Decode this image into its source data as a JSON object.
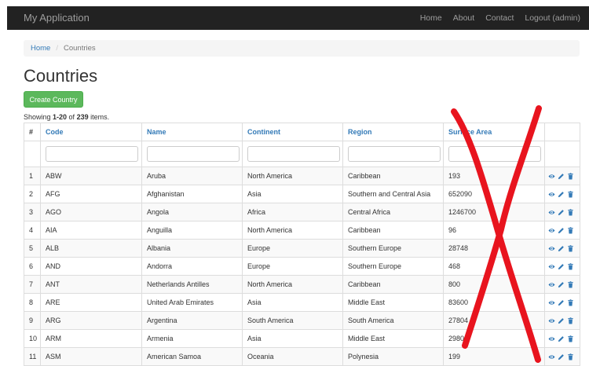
{
  "navbar": {
    "brand": "My Application",
    "links": [
      "Home",
      "About",
      "Contact",
      "Logout (admin)"
    ]
  },
  "breadcrumb": {
    "home": "Home",
    "separator": "/",
    "current": "Countries"
  },
  "page_title": "Countries",
  "create_button": "Create Country",
  "summary": {
    "prefix": "Showing ",
    "range": "1-20",
    "middle": " of ",
    "total": "239",
    "suffix": " items."
  },
  "table": {
    "headers": [
      "#",
      "Code",
      "Name",
      "Continent",
      "Region",
      "Surface Area"
    ],
    "rows": [
      [
        "1",
        "ABW",
        "Aruba",
        "North America",
        "Caribbean",
        "193"
      ],
      [
        "2",
        "AFG",
        "Afghanistan",
        "Asia",
        "Southern and Central Asia",
        "652090"
      ],
      [
        "3",
        "AGO",
        "Angola",
        "Africa",
        "Central Africa",
        "1246700"
      ],
      [
        "4",
        "AIA",
        "Anguilla",
        "North America",
        "Caribbean",
        "96"
      ],
      [
        "5",
        "ALB",
        "Albania",
        "Europe",
        "Southern Europe",
        "28748"
      ],
      [
        "6",
        "AND",
        "Andorra",
        "Europe",
        "Southern Europe",
        "468"
      ],
      [
        "7",
        "ANT",
        "Netherlands Antilles",
        "North America",
        "Caribbean",
        "800"
      ],
      [
        "8",
        "ARE",
        "United Arab Emirates",
        "Asia",
        "Middle East",
        "83600"
      ],
      [
        "9",
        "ARG",
        "Argentina",
        "South America",
        "South America",
        "27804"
      ],
      [
        "10",
        "ARM",
        "Armenia",
        "Asia",
        "Middle East",
        "2980"
      ],
      [
        "11",
        "ASM",
        "American Samoa",
        "Oceania",
        "Polynesia",
        "199"
      ]
    ],
    "row_actions": [
      "eye-icon",
      "pencil-icon",
      "trash-icon"
    ]
  },
  "colors": {
    "navbar_bg": "#222222",
    "link": "#337ab7",
    "success": "#5cb85c",
    "annotation_red": "#e8141e"
  }
}
